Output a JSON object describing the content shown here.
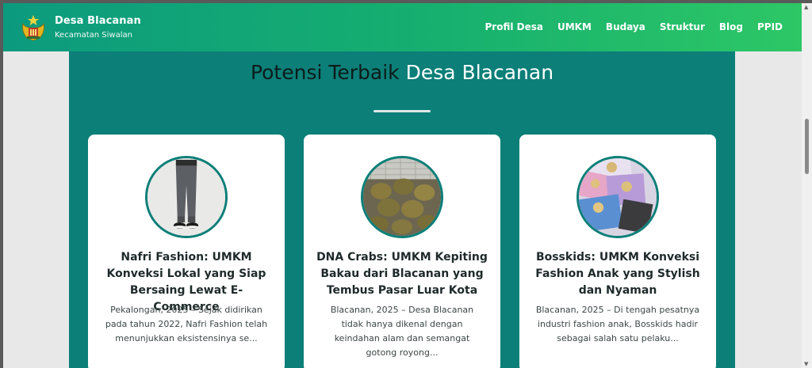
{
  "brand": {
    "name": "Desa Blacanan",
    "subtitle": "Kecamatan Siwalan"
  },
  "nav": {
    "items": [
      "Profil Desa",
      "UMKM",
      "Budaya",
      "Struktur",
      "Blog",
      "PPID"
    ]
  },
  "section": {
    "title_dark": "Potensi Terbaik",
    "title_light": "Desa Blacanan"
  },
  "cards": [
    {
      "title": "Nafri Fashion: UMKM Konveksi Lokal yang Siap Bersaing Lewat E-Commerce",
      "excerpt": "Pekalongan, 2025 – Sejak didirikan pada tahun 2022, Nafri Fashion telah menunjukkan eksistensinya se..."
    },
    {
      "title": "DNA Crabs: UMKM Kepiting Bakau dari Blacanan yang Tembus Pasar Luar Kota",
      "excerpt": "Blacanan, 2025 – Desa Blacanan tidak hanya dikenal dengan keindahan alam dan semangat gotong royong..."
    },
    {
      "title": "Bosskids: UMKM Konveksi Fashion Anak yang Stylish dan Nyaman",
      "excerpt": "Blacanan, 2025 – Di tengah pesatnya industri fashion anak, Bosskids hadir sebagai salah satu pelaku..."
    }
  ],
  "colors": {
    "navbar_start": "#0c9a7e",
    "navbar_end": "#2dc766",
    "section_bg": "#0b7f78",
    "card_bg": "#ffffff"
  }
}
